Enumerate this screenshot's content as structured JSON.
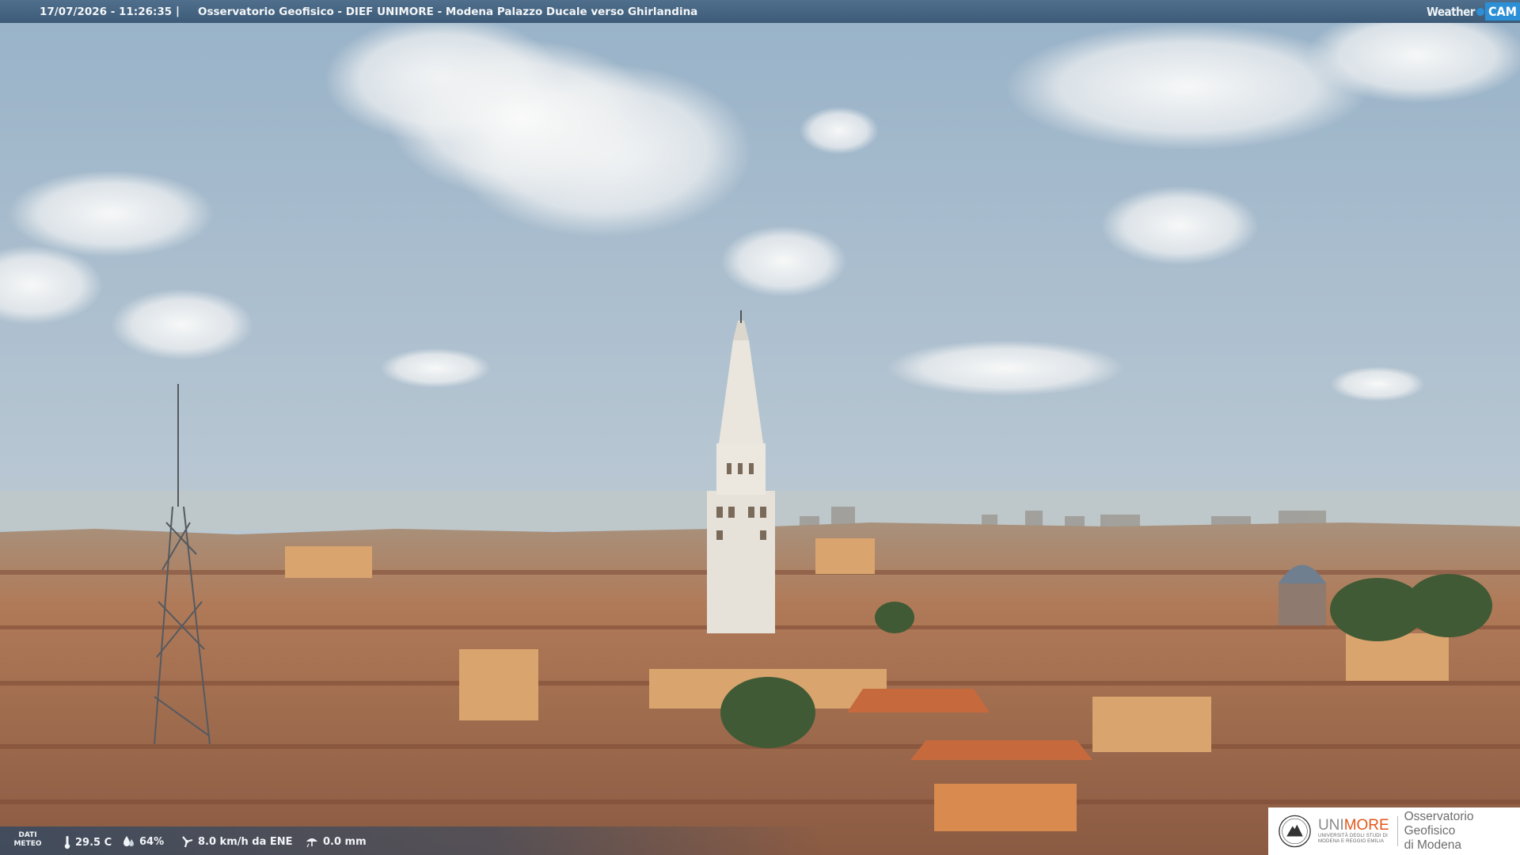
{
  "overlay": {
    "timestamp": "17/07/2026 - 11:26:35",
    "separator": "|",
    "title": "Osservatorio Geofisico - DIEF UNIMORE - Modena Palazzo Ducale verso Ghirlandina",
    "brand_weather": "Weather",
    "brand_cam": "CAM"
  },
  "meteo": {
    "label_line1": "DATI",
    "label_line2": "METEO",
    "temperature": "29.5 C",
    "humidity": "64%",
    "wind": "8.0 km/h da ENE",
    "rain": "0.0 mm",
    "icons": [
      "thermometer-icon",
      "humidity-icon",
      "wind-icon",
      "rain-icon"
    ]
  },
  "logo": {
    "uni_prefix": "UNI",
    "uni_suffix": "MORE",
    "uni_sub_line1": "UNIVERSITÀ DEGLI STUDI DI",
    "uni_sub_line2": "MODENA E REGGIO EMILIA",
    "observatory_line1": "Osservatorio Geofisico",
    "observatory_line2": "di Modena"
  },
  "colors": {
    "sky_top": "#9fb8cc",
    "sky_horizon": "#c9d2d6",
    "roofs": "#a86a4a",
    "walls": "#d8a36a",
    "tower": "#e8e4dc",
    "accent_unimore": "#e2571a",
    "brand_blue": "#2d8fd6"
  }
}
